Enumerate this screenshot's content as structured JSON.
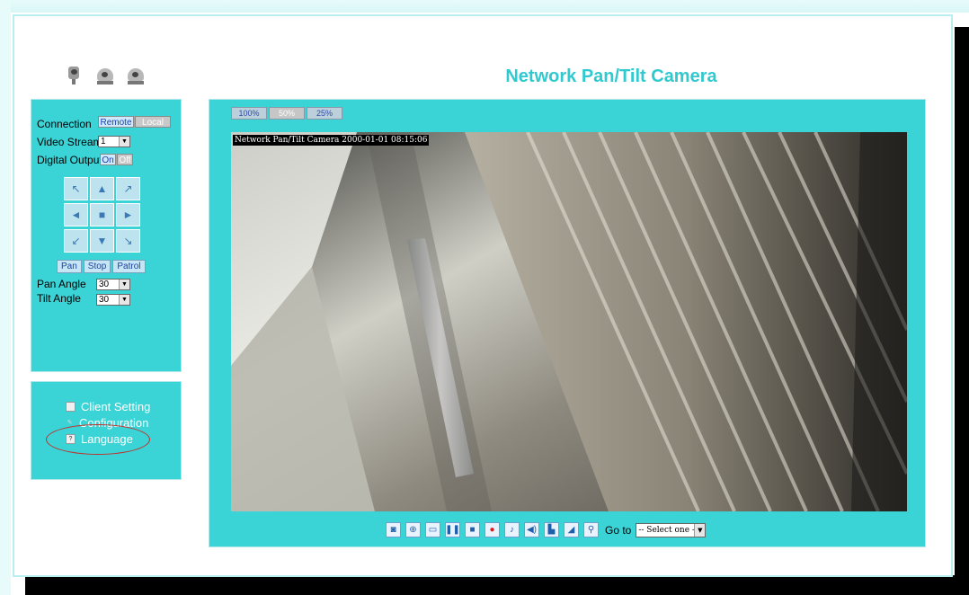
{
  "title": "Network Pan/Tilt Camera",
  "logos": [
    "camera-box-icon",
    "camera-dome-icon",
    "camera-dome-icon"
  ],
  "controls": {
    "connection_label": "Connection",
    "connection_remote": "Remote",
    "connection_local": "Local",
    "video_stream_label": "Video Stream",
    "video_stream_value": "1",
    "digital_output_label": "Digital Output",
    "digital_on": "On",
    "digital_off": "Off",
    "pad": [
      "↖",
      "▲",
      "↗",
      "◄",
      "■",
      "►",
      "↙",
      "▼",
      "↘"
    ],
    "pan": "Pan",
    "stop": "Stop",
    "patrol": "Patrol",
    "pan_angle_label": "Pan Angle",
    "pan_angle_value": "30",
    "tilt_angle_label": "Tilt Angle",
    "tilt_angle_value": "30"
  },
  "menu": {
    "client_setting": "Client Setting",
    "configuration": "Configuration",
    "language": "Language"
  },
  "video": {
    "zoom_100": "100%",
    "zoom_50": "50%",
    "zoom_25": "25%",
    "overlay": "Network Pan/Tilt Camera 2000-01-01 08:15:06"
  },
  "toolbar": {
    "icons": [
      "snapshot-icon",
      "zoom-icon",
      "fullscreen-icon",
      "pause-icon",
      "stop-icon",
      "record-icon",
      "microphone-icon",
      "speaker-icon",
      "pan-icon",
      "tilt-icon",
      "preset-icon"
    ],
    "goto_label": "Go to",
    "goto_value": "-- Select one --"
  }
}
